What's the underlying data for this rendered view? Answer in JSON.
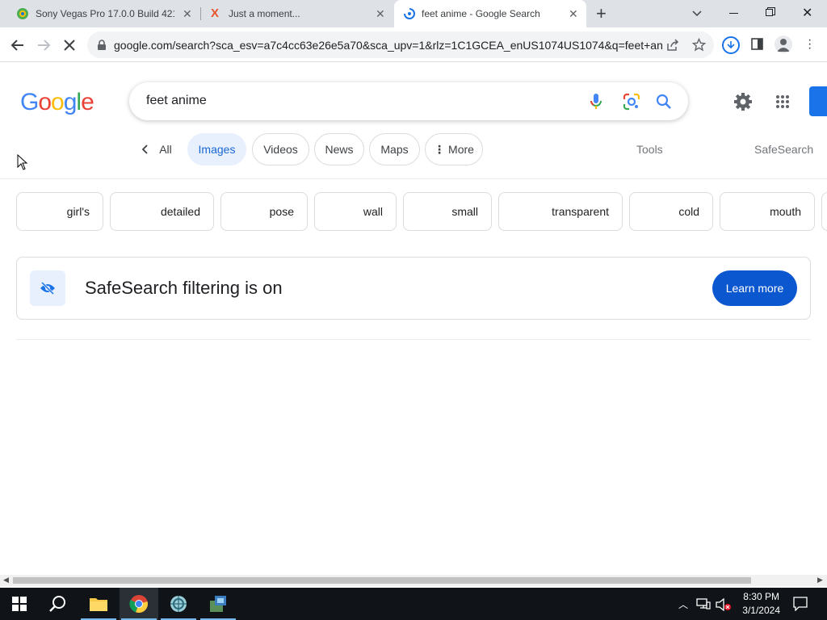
{
  "browser": {
    "tabs": [
      {
        "title": "Sony Vegas Pro 17.0.0 Build 421 |",
        "icon": "sony-vegas-favicon"
      },
      {
        "title": "Just a moment...",
        "icon": "x-red-favicon"
      },
      {
        "title": "feet anime - Google Search",
        "icon": "loading-favicon",
        "active": true
      }
    ],
    "new_tab_label": "+",
    "url": "google.com/search?sca_esv=a7c4cc63e26e5a70&sca_upv=1&rlz=1C1GCEA_enUS1074US1074&q=feet+ani..."
  },
  "google": {
    "logo": [
      "G",
      "o",
      "o",
      "g",
      "l",
      "e"
    ],
    "logo_colors": [
      "#4285f4",
      "#ea4335",
      "#fbbc05",
      "#4285f4",
      "#34a853",
      "#ea4335"
    ],
    "query": "feet anime",
    "filters": [
      {
        "label": "All",
        "has_back": true
      },
      {
        "label": "Images",
        "selected": true
      },
      {
        "label": "Videos"
      },
      {
        "label": "News"
      },
      {
        "label": "Maps"
      },
      {
        "label": "More",
        "has_dots": true
      }
    ],
    "tools_label": "Tools",
    "safesearch_label": "SafeSearch",
    "chips": [
      "girl's",
      "detailed",
      "pose",
      "wall",
      "small",
      "transparent",
      "cold",
      "mouth"
    ],
    "safesearch_notice": "SafeSearch filtering is on",
    "learn_more": "Learn more"
  },
  "taskbar": {
    "time": "8:30 PM",
    "date": "3/1/2024"
  },
  "colors": {
    "accent_blue": "#0b57d0",
    "selected_chip_bg": "#e8f0fe"
  }
}
